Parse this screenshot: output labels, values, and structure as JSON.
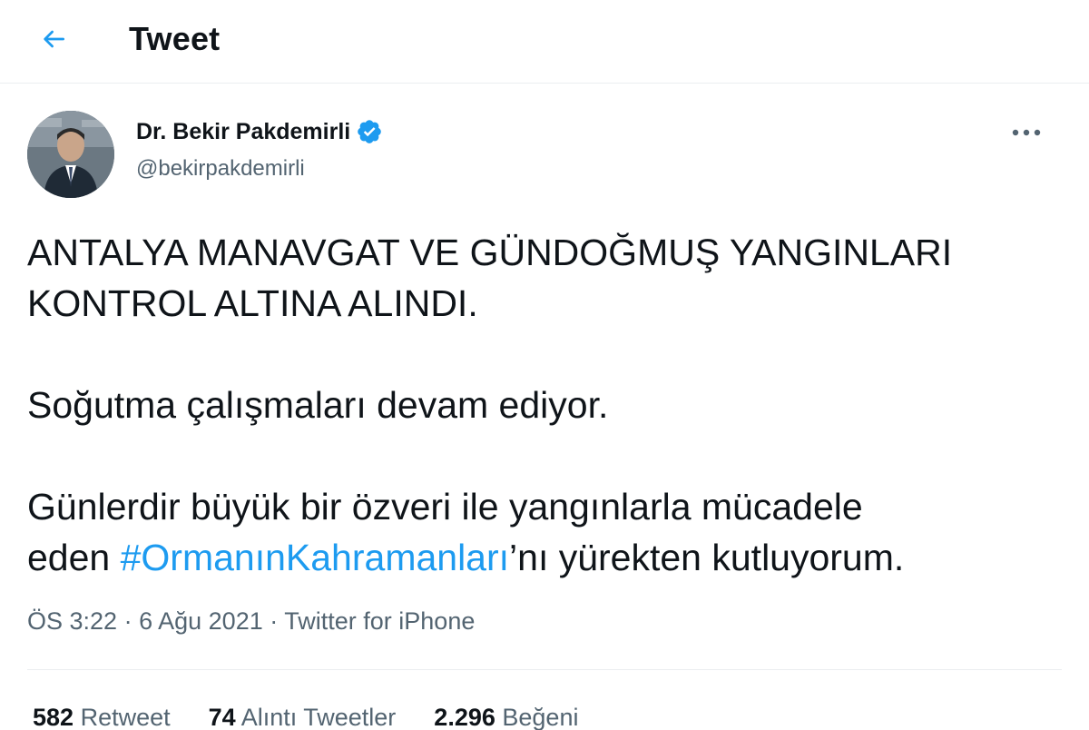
{
  "header": {
    "title": "Tweet"
  },
  "author": {
    "display_name": "Dr. Bekir Pakdemirli",
    "handle": "@bekirpakdemirli",
    "verified": true
  },
  "tweet": {
    "line1": "ANTALYA MANAVGAT VE GÜNDOĞMUŞ YANGINLARI",
    "line2": "KONTROL ALTINA ALINDI.",
    "line3": "Soğutma çalışmaları devam ediyor.",
    "line4": "Günlerdir büyük bir özveri ile yangınlarla mücadele",
    "line5_prefix": "eden ",
    "hashtag": "#OrmanınKahramanları",
    "line5_suffix": "’nı yürekten kutluyorum."
  },
  "meta": {
    "time": "ÖS 3:22",
    "separator": "·",
    "date": "6 Ağu 2021",
    "source": "Twitter for iPhone"
  },
  "stats": {
    "retweets_count": "582",
    "retweets_label": "Retweet",
    "quotes_count": "74",
    "quotes_label": "Alıntı Tweetler",
    "likes_count": "2.296",
    "likes_label": "Beğeni"
  },
  "colors": {
    "accent": "#1d9bf0",
    "secondary_text": "#536471",
    "primary_text": "#0f1419",
    "divider": "#ebeef0"
  },
  "icons": {
    "back": "arrow-left-icon",
    "verified": "verified-badge-icon",
    "more": "more-horizontal-icon"
  }
}
